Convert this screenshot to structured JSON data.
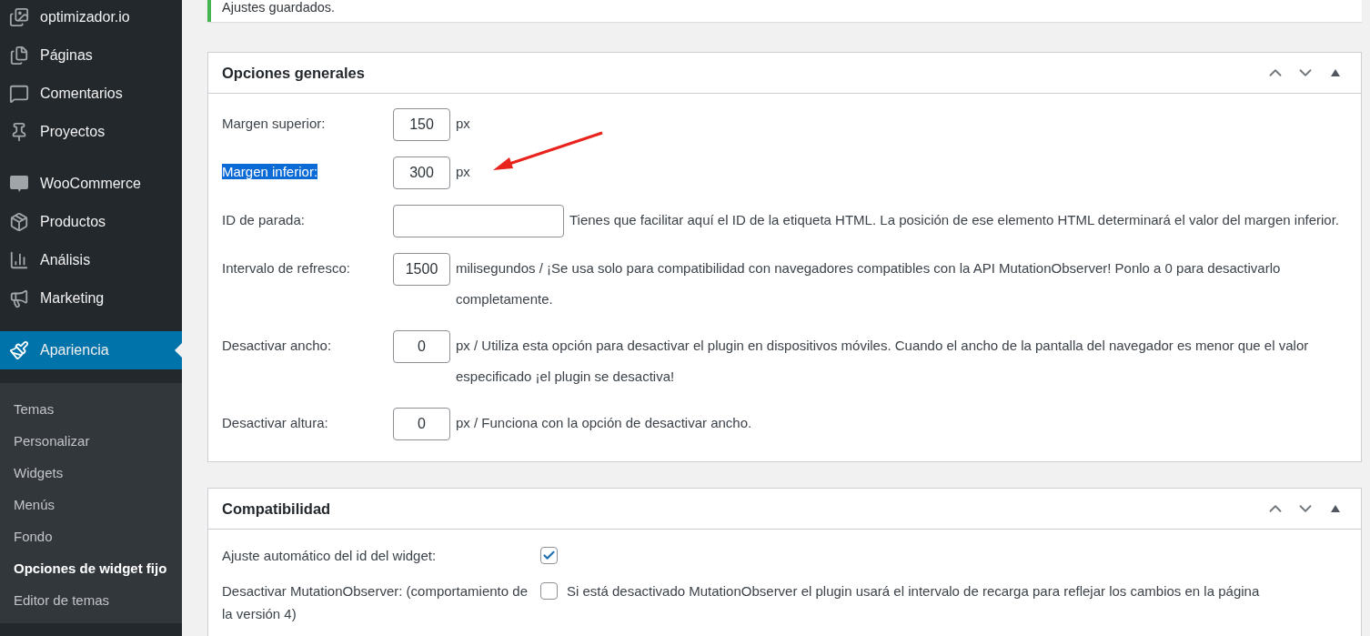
{
  "sidebar": {
    "menu_groups": [
      {
        "items": [
          {
            "label": "optimizador.io",
            "selected": false
          },
          {
            "label": "Páginas",
            "selected": false
          },
          {
            "label": "Comentarios",
            "selected": false
          },
          {
            "label": "Proyectos",
            "selected": false
          }
        ]
      },
      {
        "items": [
          {
            "label": "WooCommerce",
            "selected": false
          },
          {
            "label": "Productos",
            "selected": false
          },
          {
            "label": "Análisis",
            "selected": false
          },
          {
            "label": "Marketing",
            "selected": false
          }
        ]
      },
      {
        "items": [
          {
            "label": "Apariencia",
            "selected": true
          }
        ]
      }
    ],
    "submenu": [
      {
        "label": "Temas",
        "selected": false
      },
      {
        "label": "Personalizar",
        "selected": false
      },
      {
        "label": "Widgets",
        "selected": false
      },
      {
        "label": "Menús",
        "selected": false
      },
      {
        "label": "Fondo",
        "selected": false
      },
      {
        "label": "Opciones de widget fijo",
        "selected": true
      },
      {
        "label": "Editor de temas",
        "selected": false
      }
    ]
  },
  "notice": {
    "message": "Ajustes guardados."
  },
  "panels": [
    {
      "title": "Opciones generales",
      "rows": [
        {
          "kind": "number",
          "label": "Margen superior:",
          "highlighted": false,
          "value": "150",
          "description": "px"
        },
        {
          "kind": "number",
          "label": "Margen inferior:",
          "highlighted": true,
          "value": "300",
          "description": "px"
        },
        {
          "kind": "text",
          "label": "ID de parada:",
          "highlighted": false,
          "value": "",
          "description": "Tienes que facilitar aquí el ID de la etiqueta HTML. La posición de ese elemento HTML determinará el valor del margen inferior."
        },
        {
          "kind": "number",
          "label": "Intervalo de refresco:",
          "highlighted": false,
          "value": "1500",
          "description": "milisegundos / ¡Se usa solo para compatibilidad con navegadores compatibles con la API MutationObserver! Ponlo a 0 para desactivarlo completamente."
        },
        {
          "kind": "number",
          "label": "Desactivar ancho:",
          "highlighted": false,
          "value": "0",
          "description": "px / Utiliza esta opción para desactivar el plugin en dispositivos móviles. Cuando el ancho de la pantalla del navegador es menor que el valor especificado ¡el plugin se desactiva!"
        },
        {
          "kind": "number",
          "label": "Desactivar altura:",
          "highlighted": false,
          "value": "0",
          "description": "px / Funciona con la opción de desactivar ancho."
        }
      ]
    },
    {
      "title": "Compatibilidad",
      "rows": [
        {
          "kind": "checkbox",
          "label": "Ajuste automático del id del widget:",
          "checked": true
        },
        {
          "kind": "checkbox",
          "label": "Desactivar MutationObserver: (comportamiento de la versión 4)",
          "checked": false,
          "description": "Si está desactivado MutationObserver el plugin usará el intervalo de recarga para reflejar los cambios en la página"
        }
      ]
    }
  ]
}
